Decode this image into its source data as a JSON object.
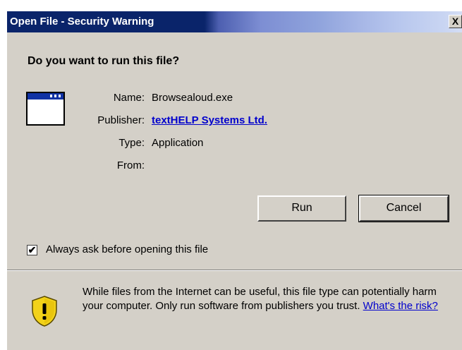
{
  "window": {
    "title": "Open File - Security Warning",
    "close_glyph": "X"
  },
  "dialog": {
    "question": "Do you want to run this file?",
    "fields": [
      {
        "label": "Name:",
        "value": "Browsealoud.exe"
      },
      {
        "label": "Publisher:",
        "value": "textHELP Systems Ltd."
      },
      {
        "label": "Type:",
        "value": "Application"
      },
      {
        "label": "From:",
        "value": ""
      }
    ],
    "buttons": {
      "run": "Run",
      "cancel": "Cancel"
    },
    "checkbox": {
      "label": "Always ask before opening this file",
      "checked": true,
      "glyph": "✔"
    },
    "warning": {
      "text": "While files from the Internet can be useful, this file type can potentially harm your computer. Only run software from publishers you trust.",
      "link": "What's the risk?"
    }
  },
  "icons": {
    "app": "application-window-icon",
    "warning": "security-shield-icon"
  },
  "colors": {
    "title_bar": "#0a246a",
    "dialog_bg": "#d4d0c8",
    "link": "#0000cc",
    "shield_yellow": "#f2d21a"
  }
}
